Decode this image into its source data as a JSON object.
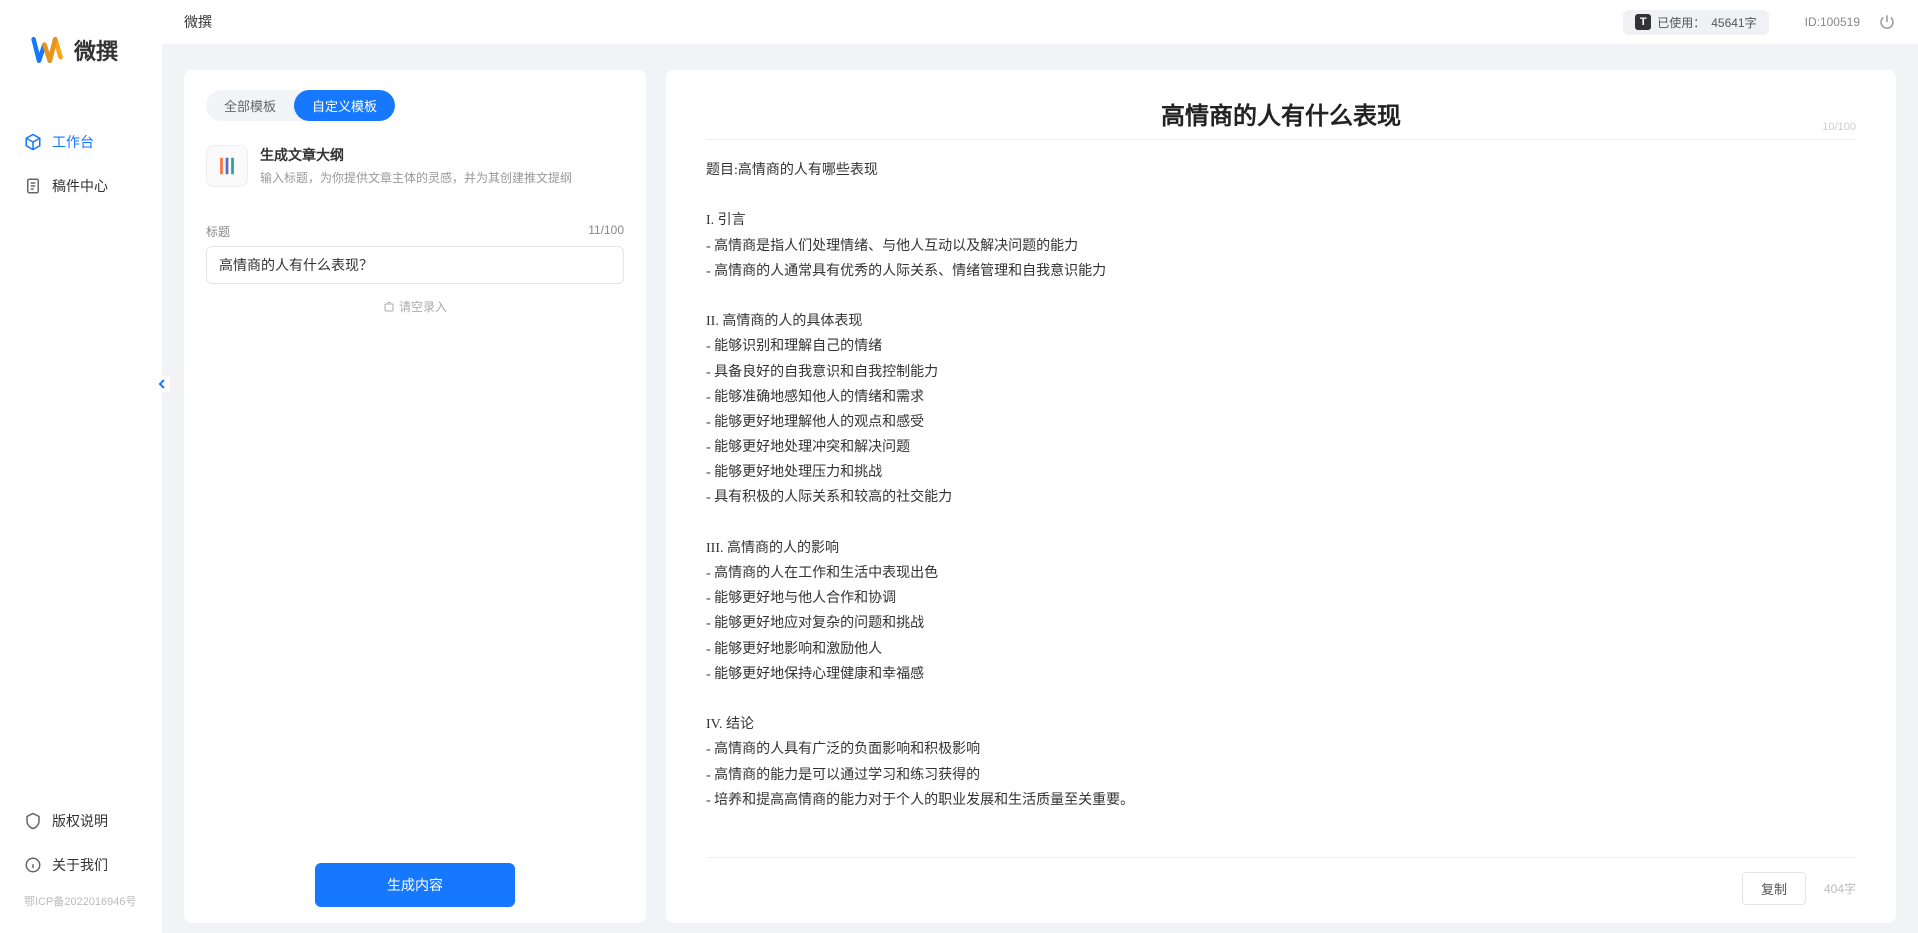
{
  "app": {
    "name": "微撰",
    "topbar_title": "微撰"
  },
  "header": {
    "usage_prefix": "已使用：",
    "usage_value": "45641字",
    "id_label": "ID:100519"
  },
  "sidebar": {
    "items": [
      {
        "label": "工作台",
        "icon": "cube"
      },
      {
        "label": "稿件中心",
        "icon": "doc"
      }
    ],
    "bottom": [
      {
        "label": "版权说明",
        "icon": "shield"
      },
      {
        "label": "关于我们",
        "icon": "info"
      }
    ],
    "icp": "鄂ICP备2022016946号"
  },
  "left": {
    "tabs": [
      "全部模板",
      "自定义模板"
    ],
    "active_tab": 1,
    "template": {
      "title": "生成文章大纲",
      "desc": "输入标题，为你提供文章主体的灵感，并为其创建推文提纲"
    },
    "field_label": "标题",
    "char_counter": "11/100",
    "input_value": "高情商的人有什么表现？",
    "record_link": "请空录入",
    "generate_btn": "生成内容"
  },
  "right": {
    "title": "高情商的人有什么表现",
    "title_counter": "10/100",
    "body": "题目:高情商的人有哪些表现\n\nI. 引言\n- 高情商是指人们处理情绪、与他人互动以及解决问题的能力\n- 高情商的人通常具有优秀的人际关系、情绪管理和自我意识能力\n\nII. 高情商的人的具体表现\n- 能够识别和理解自己的情绪\n- 具备良好的自我意识和自我控制能力\n- 能够准确地感知他人的情绪和需求\n- 能够更好地理解他人的观点和感受\n- 能够更好地处理冲突和解决问题\n- 能够更好地处理压力和挑战\n- 具有积极的人际关系和较高的社交能力\n\nIII. 高情商的人的影响\n- 高情商的人在工作和生活中表现出色\n- 能够更好地与他人合作和协调\n- 能够更好地应对复杂的问题和挑战\n- 能够更好地影响和激励他人\n- 能够更好地保持心理健康和幸福感\n\nIV. 结论\n- 高情商的人具有广泛的负面影响和积极影响\n- 高情商的能力是可以通过学习和练习获得的\n- 培养和提高高情商的能力对于个人的职业发展和生活质量至关重要。",
    "copy_btn": "复制",
    "word_count": "404字"
  }
}
